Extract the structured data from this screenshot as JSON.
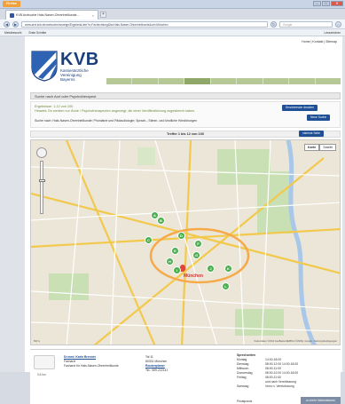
{
  "browser": {
    "app_label": "Firefox",
    "tab_title": "KVB Arztsuche Hals-Nasen-Ohrenheilkunde...",
    "url": "www.arzt.kvb.de/arztsuche/anzeige/ErgebnisListe?s=Fachrichtung&fa=Hals-Nasen-Ohrenheilkunde&ort=München",
    "search_engine": "Google",
    "bookmarks": [
      "Meistbesucht",
      "Erste Schritte"
    ],
    "bookmarks_right": "Lesezeichen"
  },
  "site": {
    "top_links": "Home | Kontakt | Sitemap",
    "logo_text": "KVB",
    "logo_sub": [
      "Kassenärztliche",
      "Vereinigung",
      "Bayerns"
    ],
    "nav": [
      "",
      "",
      "",
      "",
      "",
      "",
      "",
      "",
      ""
    ]
  },
  "search": {
    "header": "Suche nach Arzt oder Psychotherapeut",
    "line1": "Ergebnisse: 1-12 von 100",
    "line2": "Hinweis: Es werden nur Ärzte / Psychotherapeuten angezeigt, die einer Veröffentlichung zugestimmt haben.",
    "line3": "Suche nach: Hals-Nasen-Ohrenheilkunde; Phoniatrie und Pädaudiologie; Sprach-, Stimm- und kindliche Hörstörungen",
    "btn_print": "Druckversion drucken",
    "btn_new": "Neue Suche",
    "hits": "Treffer 1 bis 12 von 100",
    "btn_next": "nächste Seite"
  },
  "map": {
    "type_map": "Karte",
    "type_sat": "Satellit",
    "city_label": "München",
    "markers": [
      "A",
      "B",
      "C",
      "D",
      "E",
      "F",
      "G",
      "H",
      "I",
      "J",
      "K",
      "L"
    ],
    "copyright": "Kartendaten ©2012 GeoBasis-DE/BKG (©2009), Google - Nutzungsbedingungen",
    "scale": "500 m"
  },
  "result": {
    "distance": "0,6 km",
    "name": "Dr.med. Karin Brenner",
    "line2": "Facharzt",
    "line3": "Facharzt für Hals-Nasen-Ohrenheilkunde",
    "address_label": "Tal 11",
    "city": "80331 München",
    "route": "Routenplaner",
    "tel_label": "Tel.:",
    "tel": "089-222141",
    "hours_title": "Sprechzeiten",
    "hours": [
      [
        "Montag",
        "14:00-18:00"
      ],
      [
        "Dienstag",
        "08:00-12:00 14:00-18:00"
      ],
      [
        "Mittwoch",
        "08:00-11:00"
      ],
      [
        "Donnerstag",
        "08:00-12:00 14:00-18:00"
      ],
      [
        "Freitag",
        "08:00-11:00"
      ],
      [
        "",
        "und nach Vereinbarung"
      ],
      [
        "Samstag",
        "Venn n. Vereinbarung"
      ]
    ],
    "contact_label": "Privatpraxis",
    "more": "zu mehr Informationen"
  },
  "colors": {
    "brand": "#1b3f7a",
    "button": "#1f4f94",
    "marker": "#4caf50"
  }
}
